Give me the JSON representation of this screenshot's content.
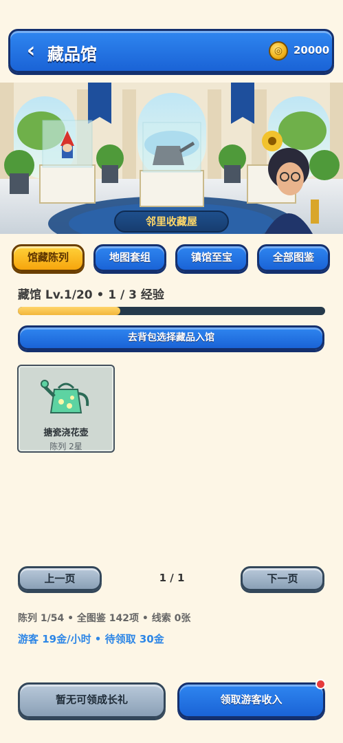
{
  "header": {
    "back_symbol": "‹",
    "title": "藏品馆",
    "coin_icon": "coin-icon",
    "coins": "20000"
  },
  "banner": {
    "label": "邻里收藏屋"
  },
  "tabs": [
    {
      "label": "馆藏陈列",
      "active": true
    },
    {
      "label": "地图套组",
      "active": false
    },
    {
      "label": "镇馆至宝",
      "active": false
    },
    {
      "label": "全部图鉴",
      "active": false
    }
  ],
  "museum": {
    "level_text": "藏馆 Lv.1/20 • 1 / 3 经验",
    "xp_fraction": 0.333,
    "select_button": "去背包选择藏品入馆"
  },
  "items": [
    {
      "name": "搪瓷浇花壶",
      "sub": "陈列 2星",
      "icon": "watering-can-icon"
    }
  ],
  "pager": {
    "prev": "上一页",
    "indicator": "1 / 1",
    "next": "下一页"
  },
  "stats": {
    "line1": "陈列 1/54 • 全图鉴 142项 • 线索 0张",
    "line2": "游客 19金/小时 • 待领取 30金"
  },
  "bottom": {
    "gift_button": "暂无可领成长礼",
    "collect_button": "领取游客收入",
    "collect_has_notification": true
  },
  "colors": {
    "accent_blue": "#1a63d6",
    "accent_gold": "#f6a50d",
    "background": "#fdf6e6",
    "visitor_text": "#2d86e6"
  }
}
